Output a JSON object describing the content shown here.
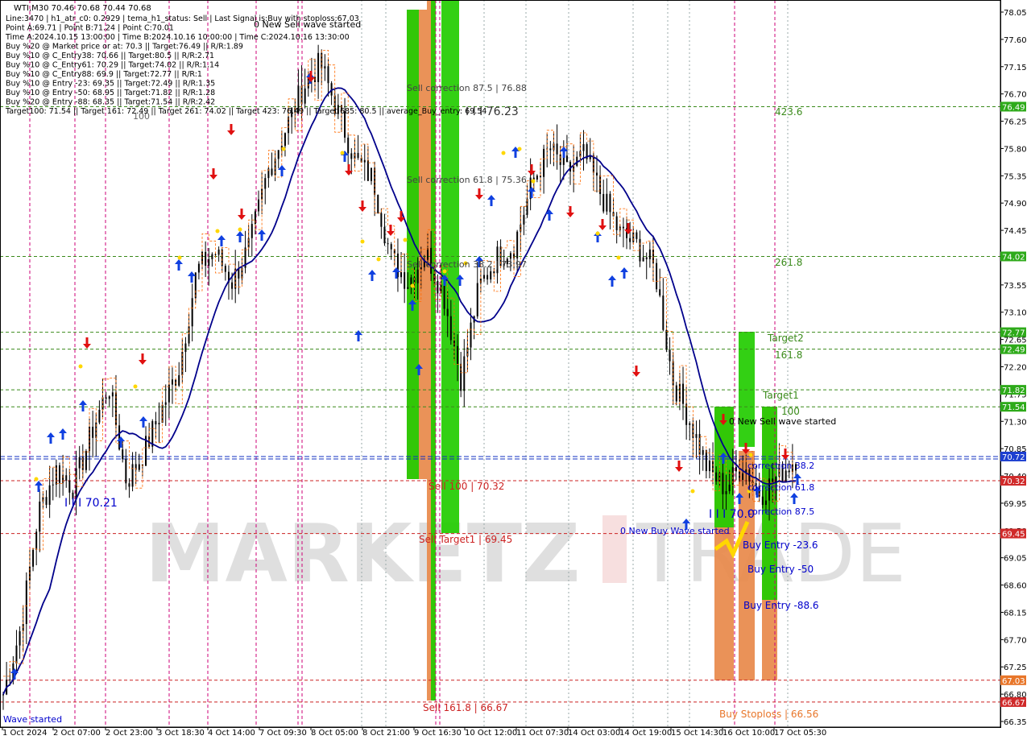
{
  "header": {
    "symbol_line": "WTI,M30  70.46 70.68 70.44 70.68",
    "lines": [
      "Line:3470  | h1_atr_c0: 0.2929  | tema_h1_status: Sell  | Last Signal is:Buy with stoploss:67.03",
      "Point A:69.71  | Point B:71.24  | Point C:70.01",
      "Time A:2024.10.15 13:00:00  | Time B:2024.10.16 10:00:00  | Time C:2024.10.16 13:30:00",
      "Buy %20 @ Market price or at: 70.3  || Target:76.49  || R/R:1.89",
      "Buy %10 @ C_Entry38: 70.66  || Target:80.5  || R/R:2.71",
      "Buy %10 @ C_Entry61: 70.29  || Target:74.02  || R/R:1.14",
      "Buy %10 @ C_Entry88: 69.9  || Target:72.77  || R/R:1",
      "Buy %10 @ Entry -23: 69.35  || Target:72.49  || R/R:1.35",
      "Buy %10 @ Entry -50: 68.95  || Target:71.82  || R/R:1.28",
      "Buy %20 @ Entry -88: 68.35  || Target:71.54  || R/R:2.42",
      "Target100: 71.54  || Target 161: 72.49  || Target 261: 74.02  || Target 423: 76.49  || Target 685: 80.5  || average_Buy_entry: 69.54"
    ]
  },
  "colors": {
    "background": "#ffffff",
    "candle": "#000000",
    "ma_line": "#00008b",
    "orange_line": "#ff6a00",
    "green_zone": "#22cc00",
    "orange_zone": "#e8894a",
    "target_green": "#3a8a1a",
    "level_red": "#cc2222",
    "blue_text": "#0000cc",
    "magenta_vline": "#cc0077"
  },
  "price_axis": {
    "ticks": [
      "78.05",
      "77.60",
      "77.15",
      "76.70",
      "76.25",
      "75.80",
      "75.35",
      "74.90",
      "74.45",
      "74.00",
      "73.55",
      "73.10",
      "72.65",
      "72.20",
      "71.75",
      "71.30",
      "70.85",
      "70.40",
      "69.95",
      "69.50",
      "69.05",
      "68.60",
      "68.15",
      "67.70",
      "67.25",
      "66.80",
      "66.35"
    ],
    "badges": [
      {
        "label": "76.49",
        "type": "green"
      },
      {
        "label": "74.02",
        "type": "green"
      },
      {
        "label": "72.77",
        "type": "green"
      },
      {
        "label": "72.49",
        "type": "green"
      },
      {
        "label": "71.82",
        "type": "green"
      },
      {
        "label": "71.54",
        "type": "green"
      },
      {
        "label": "70.72",
        "type": "blue"
      },
      {
        "label": "70.32",
        "type": "red"
      },
      {
        "label": "69.45",
        "type": "red"
      },
      {
        "label": "67.03",
        "type": "orange"
      },
      {
        "label": "66.67",
        "type": "red"
      }
    ]
  },
  "time_axis": {
    "labels": [
      "1 Oct 2024",
      "2 Oct 07:00",
      "2 Oct 23:00",
      "3 Oct 18:30",
      "4 Oct 14:00",
      "7 Oct 09:30",
      "8 Oct 05:00",
      "8 Oct 21:00",
      "9 Oct 16:30",
      "10 Oct 12:00",
      "11 Oct 07:30",
      "14 Oct 03:00",
      "14 Oct 19:00",
      "15 Oct 14:30",
      "16 Oct 10:00",
      "17 Oct 05:30"
    ]
  },
  "annotations": {
    "sell_wave_top": "0 New Sell wave started",
    "sell_correction_875": "Sell correction 87.5 | 76.88",
    "sell_correction_618": "Sell correction 61.8 | 75.36",
    "sell_correction_382": "Sell correction 38.2 | 73.97",
    "level_7623": "I I I 76.23",
    "sell_100": "Sell 100 | 70.32",
    "sell_target1": "Sell Target1 | 69.45",
    "sell_1618": "Sell 161.8 | 66.67",
    "level_7021": "I I I 70.21",
    "wave_started": "Wave started",
    "t4236": "423.6",
    "t2618": "261.8",
    "target2": "Target2",
    "t1618": "161.8",
    "target1": "Target1",
    "t100": "100",
    "new_sell_wave": "0 New Sell wave started",
    "correction_382": "correction 38.2",
    "correction_618": "correction 61.8",
    "correction_875": "correction 87.5",
    "level_70": "I I I 70.0",
    "new_buy_wave": "0 New Buy Wave started",
    "buy_entry_236": "Buy Entry -23.6",
    "buy_entry_50": "Buy Entry -50",
    "buy_entry_886": "Buy Entry -88.6",
    "buy_stoploss": "Buy Stoploss | 66.56",
    "top_left_100": "100"
  },
  "chart_data": {
    "type": "candlestick",
    "title": "WTI,M30",
    "ylim": [
      66.35,
      78.15
    ],
    "x_labels": [
      "1 Oct 2024",
      "2 Oct 07:00",
      "2 Oct 23:00",
      "3 Oct 18:30",
      "4 Oct 14:00",
      "7 Oct 09:30",
      "8 Oct 05:00",
      "8 Oct 21:00",
      "9 Oct 16:30",
      "10 Oct 12:00",
      "11 Oct 07:30",
      "14 Oct 03:00",
      "14 Oct 19:00",
      "15 Oct 14:30",
      "16 Oct 10:00",
      "17 Oct 05:30"
    ],
    "last_price": 70.72,
    "close_path": [
      66.8,
      67.9,
      69.8,
      70.5,
      70.2,
      71.1,
      71.9,
      70.3,
      70.8,
      71.5,
      72.2,
      73.8,
      74.1,
      73.6,
      74.2,
      75.4,
      76.1,
      76.8,
      77.2,
      76.4,
      75.6,
      75.3,
      74.0,
      73.6,
      74.1,
      73.4,
      72.0,
      73.5,
      74.0,
      74.2,
      75.2,
      75.8,
      75.4,
      75.7,
      75.0,
      74.4,
      74.2,
      73.8,
      72.0,
      71.3,
      70.5,
      70.2,
      70.6,
      70.1,
      70.4,
      70.7
    ],
    "levels": {
      "target_423": 76.49,
      "target_261": 74.02,
      "target2": 72.77,
      "target_161": 72.49,
      "target1": 71.82,
      "target_100": 71.54,
      "current": 70.72,
      "sell_100": 70.32,
      "sell_target1": 69.45,
      "buy_stoploss": 67.03,
      "sell_161": 66.67
    }
  }
}
